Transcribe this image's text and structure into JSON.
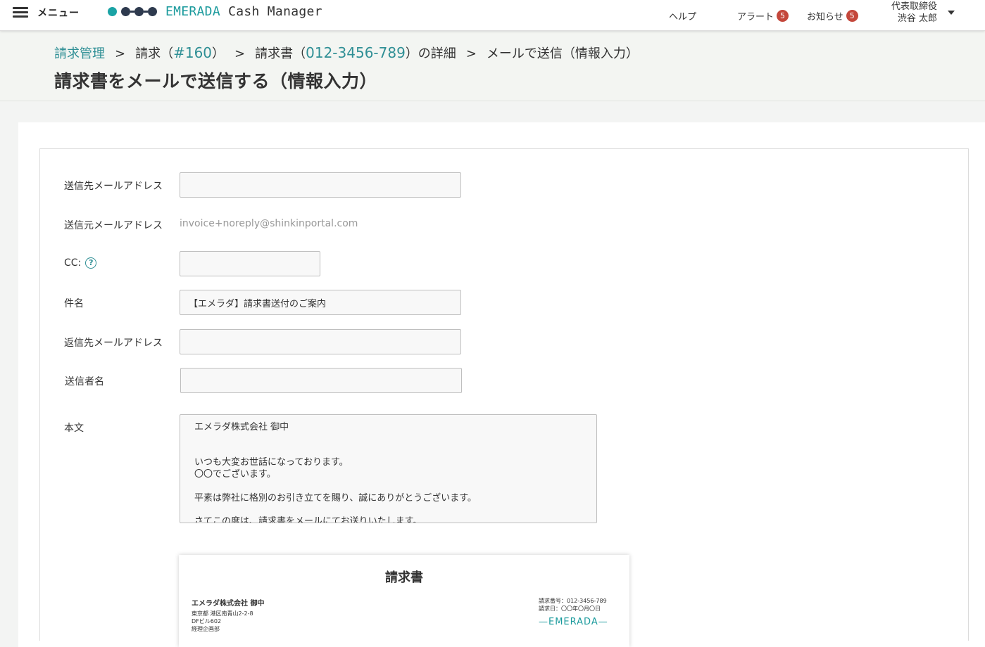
{
  "header": {
    "menu_label": "メニュー",
    "brand": "EMERADA",
    "product": " Cash Manager",
    "help": "ヘルプ",
    "alert": "アラート",
    "alert_count": "5",
    "notice": "お知らせ",
    "notice_count": "5",
    "user_role": "代表取締役",
    "user_name": "渋谷 太郎"
  },
  "breadcrumb": {
    "item1": "請求管理",
    "sep": ">",
    "item2_prefix": "請求（",
    "item2_link": "#160",
    "item2_suffix": "）",
    "item3_prefix": "請求書（",
    "item3_link": "012-3456-789",
    "item3_suffix": "）の詳細",
    "item4": "メールで送信（情報入力）"
  },
  "page_title": "請求書をメールで送信する（情報入力）",
  "form": {
    "to_label": "送信先メールアドレス",
    "to_value": "",
    "from_label": "送信元メールアドレス",
    "from_value": "invoice+noreply@shinkinportal.com",
    "cc_label": "CC:",
    "cc_help": "?",
    "cc_value": "",
    "subject_label": "件名",
    "subject_value": "【エメラダ】請求書送付のご案内",
    "reply_label": "返信先メールアドレス",
    "reply_value": "",
    "sender_label": "送信者名",
    "sender_value": "",
    "body_label": "本文",
    "body_lines": {
      "l1": "エメラダ株式会社 御中",
      "l2": "いつも大変お世話になっております。",
      "l3": "〇〇でございます。",
      "l4": "平素は弊社に格別のお引き立てを賜り、誠にありがとうございます。",
      "l5": "さてこの度は、請求書をメールにてお送りいたします。"
    }
  },
  "preview": {
    "title": "請求書",
    "client": "エメラダ株式会社 御中",
    "addr1": "東京都 港区南青山2-2-8",
    "addr2": "DFビル602",
    "addr3": "経理企画部",
    "invoice_no": "請求番号：012-3456-789",
    "invoice_date": "請求日：〇〇年〇月〇日",
    "logo": "—EMERADA—"
  },
  "colors": {
    "accent": "#2f8f95",
    "badge": "#c4473b"
  }
}
